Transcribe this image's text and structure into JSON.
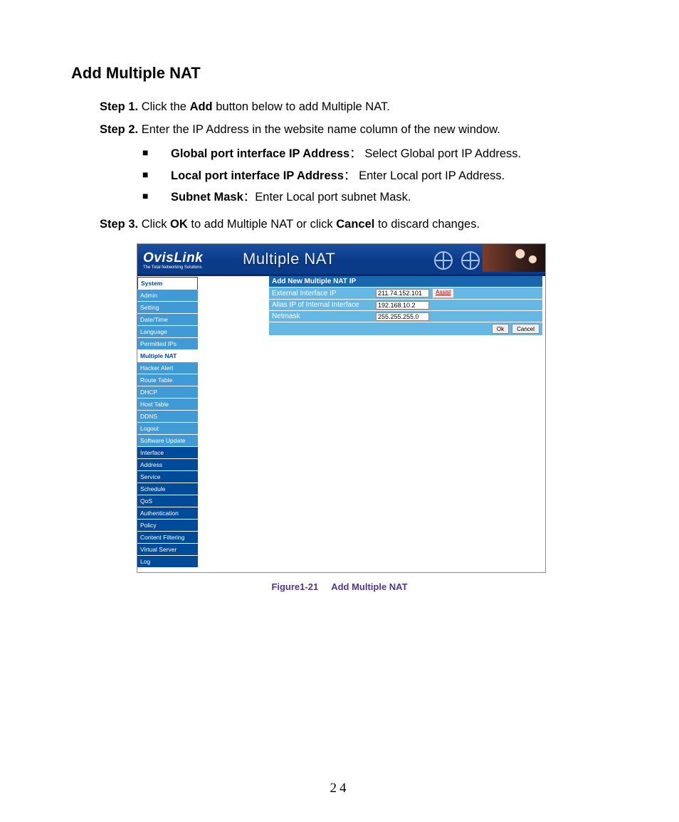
{
  "title": "Add Multiple NAT",
  "steps": [
    {
      "label": "Step 1.",
      "pre": "Click the ",
      "bold1": "Add",
      "post": " button below to add Multiple NAT."
    },
    {
      "label": "Step 2.",
      "pre": "Enter the IP Address in the website name column of the new window.",
      "bold1": "",
      "post": ""
    },
    {
      "label": "Step 3.",
      "pre": "Click ",
      "bold1": "OK",
      "mid": " to add Multiple NAT or click ",
      "bold2": "Cancel",
      "post": " to discard changes."
    }
  ],
  "bullets": [
    {
      "bold": "Global port interface IP Address",
      "sep": "：  ",
      "text": "Select Global port IP Address."
    },
    {
      "bold": "Local port interface IP Address",
      "sep": "：  ",
      "text": "Enter Local port IP Address."
    },
    {
      "bold": "Subnet Mask",
      "sep": "：",
      "text": "Enter Local port subnet Mask."
    }
  ],
  "screenshot": {
    "brand": "OvisLink",
    "brand_sub": "The Total Networking Solutions",
    "header_title": "Multiple NAT",
    "nav_sections": {
      "system": "System",
      "system_items": [
        "Admin",
        "Setting",
        "Date/Time",
        "Language",
        "Permitted IPs",
        "Multiple NAT",
        "Hacker Alert",
        "Route Table",
        "DHCP",
        "Host Table",
        "DDNS",
        "Logout",
        "Software Update"
      ],
      "active_index": 5,
      "others": [
        "Interface",
        "Address",
        "Service",
        "Schedule",
        "QoS",
        "Authentication",
        "Policy",
        "Content Filtering",
        "Virtual Server",
        "Log"
      ]
    },
    "form": {
      "title": "Add New Multiple NAT IP",
      "rows": [
        {
          "label": "External Interface IP",
          "value": "211.74.152.101",
          "assist": true
        },
        {
          "label": "Alias IP of Internal Interface",
          "value": "192.168.10.2",
          "assist": false
        },
        {
          "label": "Netmask",
          "value": "255.255.255.0",
          "assist": false
        }
      ],
      "assist_label": "Assist",
      "ok": "Ok",
      "cancel": "Cancel"
    }
  },
  "figure": {
    "num": "Figure1-21",
    "title": "Add Multiple NAT"
  },
  "page_number": "24"
}
